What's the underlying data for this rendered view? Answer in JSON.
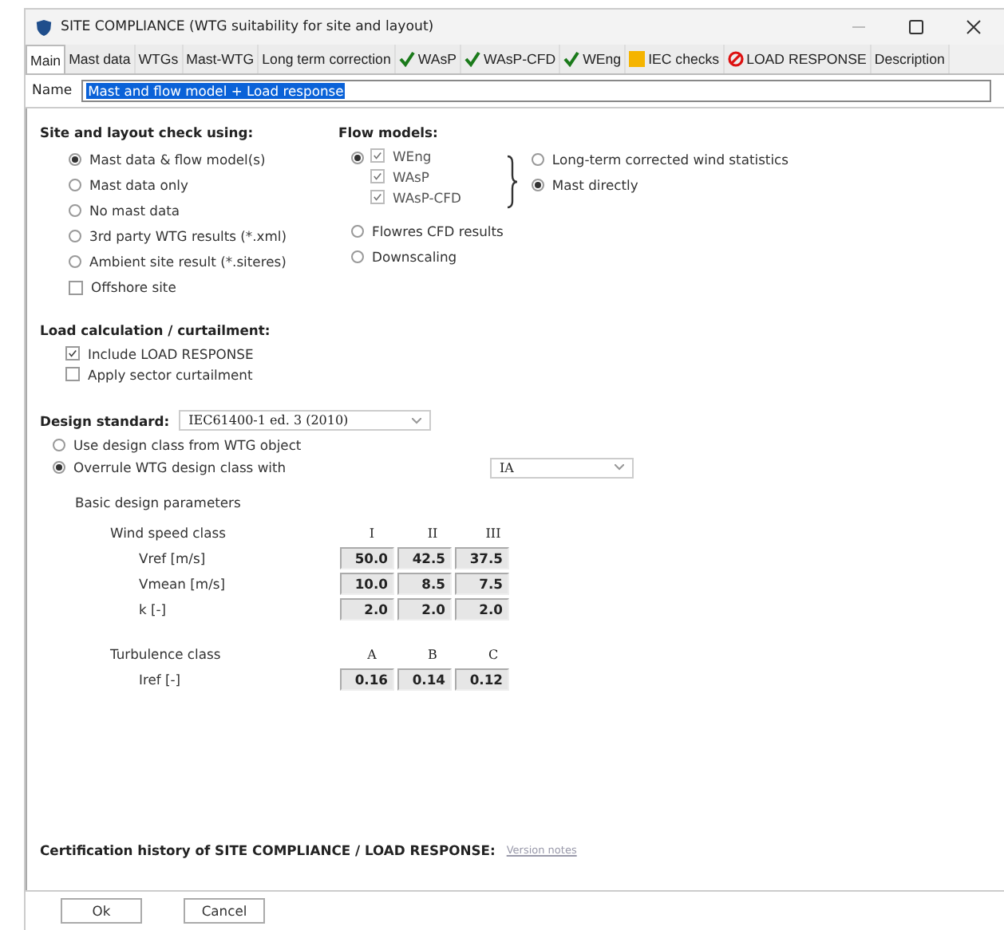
{
  "window": {
    "title": "SITE COMPLIANCE (WTG suitability for site and layout)"
  },
  "tabs": [
    {
      "label": "Main",
      "selected": true,
      "kind": "plain"
    },
    {
      "label": "Mast data",
      "selected": false,
      "kind": "plain"
    },
    {
      "label": "WTGs",
      "selected": false,
      "kind": "plain"
    },
    {
      "label": "Mast-WTG",
      "selected": false,
      "kind": "plain"
    },
    {
      "label": "Long term correction",
      "selected": false,
      "kind": "plain"
    },
    {
      "label": "WAsP",
      "selected": false,
      "kind": "ok"
    },
    {
      "label": "WAsP-CFD",
      "selected": false,
      "kind": "ok"
    },
    {
      "label": "WEng",
      "selected": false,
      "kind": "ok"
    },
    {
      "label": "IEC checks",
      "selected": false,
      "kind": "warning"
    },
    {
      "label": "LOAD RESPONSE",
      "selected": false,
      "kind": "error"
    },
    {
      "label": "Description",
      "selected": false,
      "kind": "plain"
    }
  ],
  "name_field": {
    "label": "Name",
    "value": "Mast and flow model + Load response"
  },
  "site_check": {
    "heading": "Site and layout check using:",
    "options": [
      {
        "kind": "radio",
        "label": "Mast data & flow model(s)",
        "selected": true
      },
      {
        "kind": "radio",
        "label": "Mast data only",
        "selected": false
      },
      {
        "kind": "radio",
        "label": "No mast data",
        "selected": false
      },
      {
        "kind": "radio",
        "label": "3rd party WTG results (*.xml)",
        "selected": false
      },
      {
        "kind": "radio",
        "label": "Ambient site result (*.siteres)",
        "selected": false
      },
      {
        "kind": "checkbox",
        "label": "Offshore site",
        "checked": false
      }
    ]
  },
  "flow_models": {
    "heading": "Flow models:",
    "group_selected": true,
    "models": [
      {
        "label": "WEng",
        "checked": true,
        "disabled": true
      },
      {
        "label": "WAsP",
        "checked": true,
        "disabled": true
      },
      {
        "label": "WAsP-CFD",
        "checked": true,
        "disabled": true
      }
    ],
    "sources": [
      {
        "label": "Long-term corrected wind statistics",
        "selected": false
      },
      {
        "label": "Mast directly",
        "selected": true
      }
    ],
    "others": [
      {
        "label": "Flowres CFD results",
        "selected": false
      },
      {
        "label": "Downscaling",
        "selected": false
      }
    ]
  },
  "load": {
    "heading": "Load calculation / curtailment:",
    "options": [
      {
        "label": "Include LOAD RESPONSE",
        "checked": true
      },
      {
        "label": "Apply sector curtailment",
        "checked": false
      }
    ]
  },
  "design_standard": {
    "label": "Design standard:",
    "value": "IEC61400-1 ed. 3 (2010)"
  },
  "design_class": {
    "options": [
      {
        "label": "Use design class from WTG object",
        "selected": false
      },
      {
        "label": "Overrule WTG design class with",
        "selected": true
      }
    ],
    "value": "IA"
  },
  "basic": {
    "heading": "Basic design parameters",
    "tables": [
      {
        "label": "Wind speed class",
        "columns": [
          "I",
          "II",
          "III"
        ],
        "rows": [
          {
            "label": "Vref [m/s]",
            "values": [
              "50.0",
              "42.5",
              "37.5"
            ]
          },
          {
            "label": "Vmean [m/s]",
            "values": [
              "10.0",
              "8.5",
              "7.5"
            ]
          },
          {
            "label": "k [-]",
            "values": [
              "2.0",
              "2.0",
              "2.0"
            ]
          }
        ]
      },
      {
        "label": "Turbulence class",
        "columns": [
          "A",
          "B",
          "C"
        ],
        "rows": [
          {
            "label": "Iref [-]",
            "values": [
              "0.16",
              "0.14",
              "0.12"
            ]
          }
        ]
      }
    ]
  },
  "certification": {
    "label": "Certification history of SITE COMPLIANCE / LOAD RESPONSE:",
    "link": "Version notes"
  },
  "buttons": [
    "Ok",
    "Cancel"
  ]
}
